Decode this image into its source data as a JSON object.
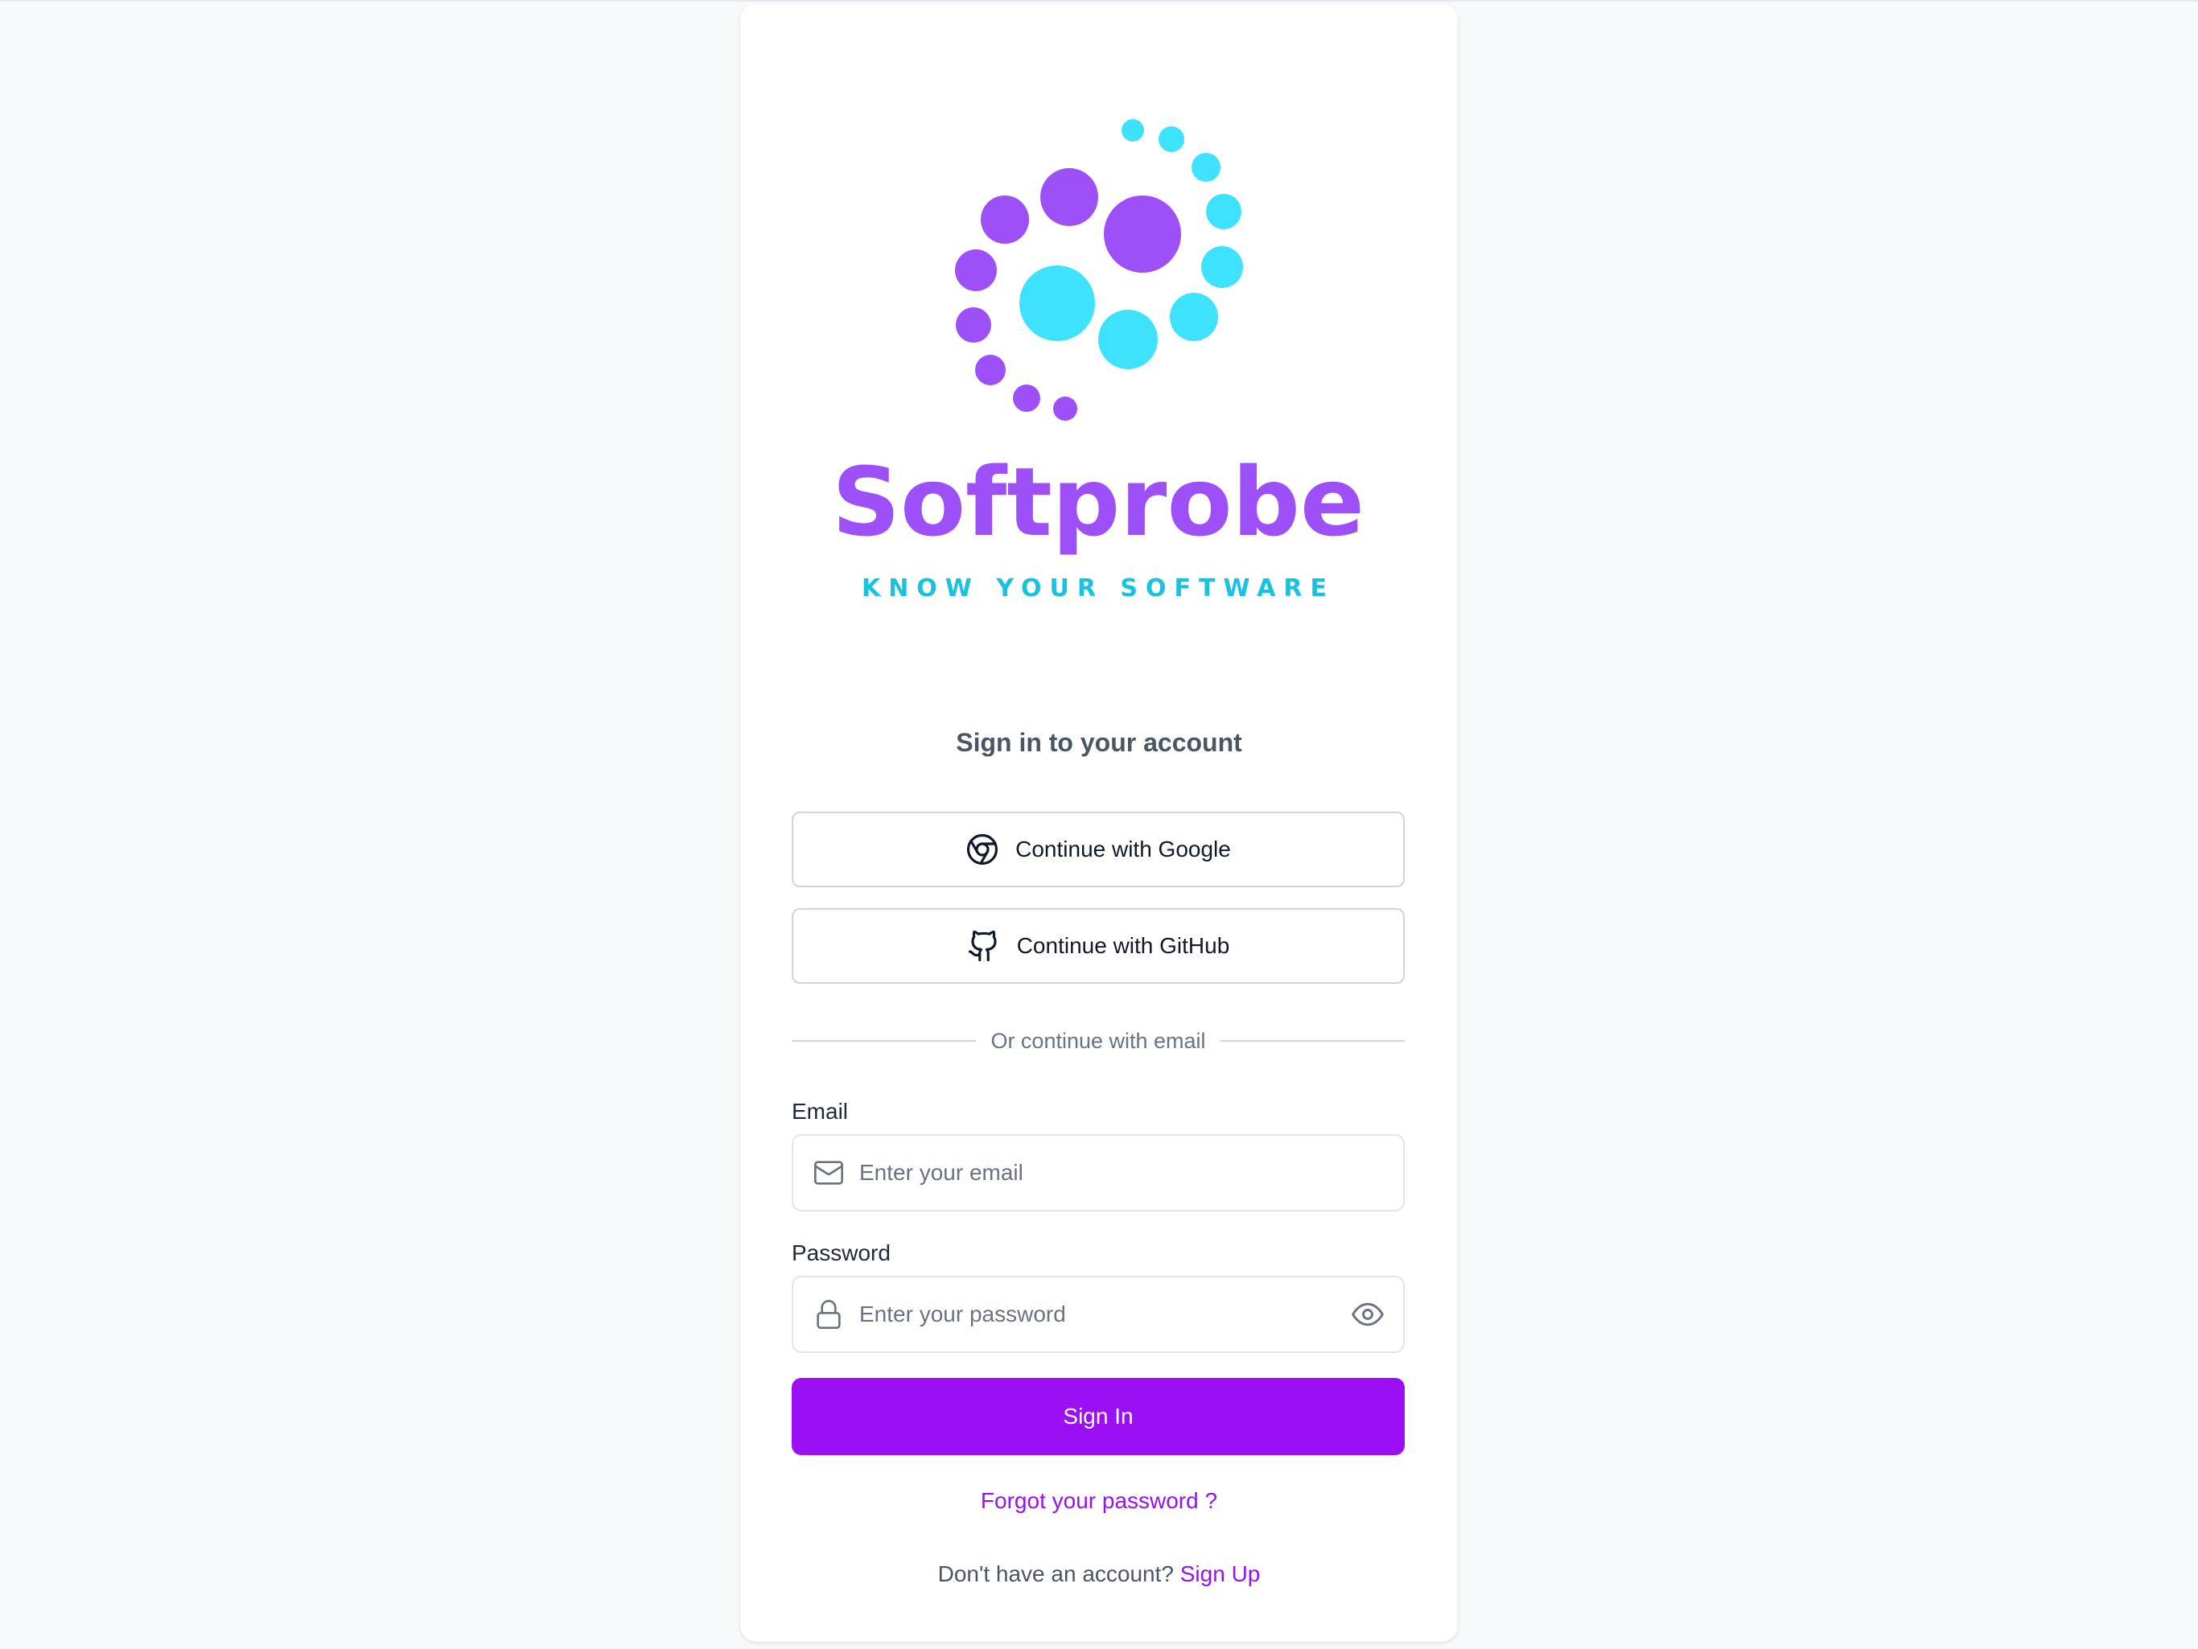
{
  "brand": {
    "name": "Softprobe",
    "tagline": "KNOW YOUR SOFTWARE",
    "primary_color": "#9a0ff4",
    "logo_purple": "#9d50f7",
    "logo_cyan": "#3ee2fd",
    "tagline_color": "#19c2de"
  },
  "auth": {
    "heading": "Sign in to your account",
    "google_button": "Continue with Google",
    "github_button": "Continue with GitHub",
    "divider_text": "Or continue with email",
    "email": {
      "label": "Email",
      "placeholder": "Enter your email",
      "value": ""
    },
    "password": {
      "label": "Password",
      "placeholder": "Enter your password",
      "value": ""
    },
    "sign_in_button": "Sign In",
    "forgot_link": "Forgot your password ?",
    "signup_prompt": "Don't have an account?",
    "signup_link": "Sign Up"
  },
  "icons": {
    "google": "chrome-icon",
    "github": "github-icon",
    "email": "mail-icon",
    "password": "lock-icon",
    "toggle_visibility": "eye-icon"
  }
}
